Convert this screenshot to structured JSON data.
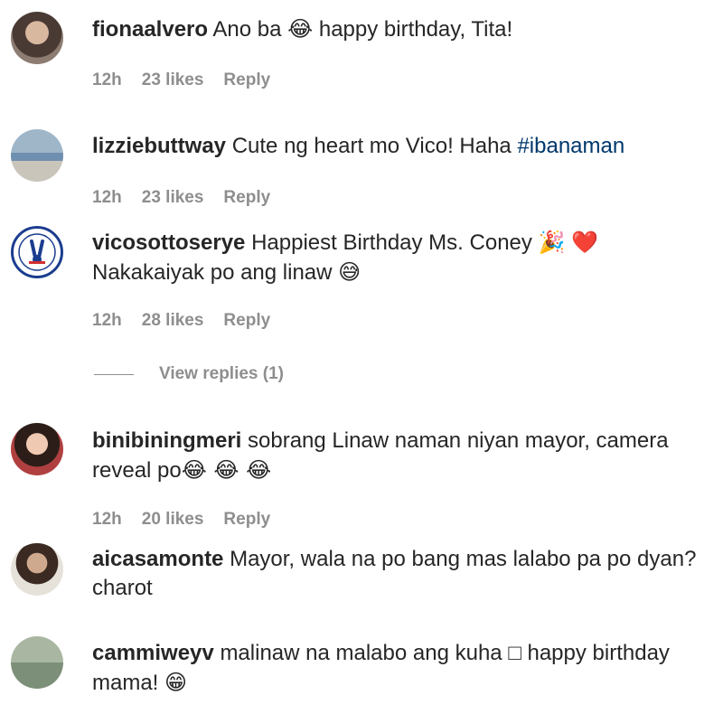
{
  "comments": [
    {
      "user": "fionaalvero",
      "text_before": "Ano ba ",
      "emoji": "😂",
      "text_after": " happy birthday, Tita!",
      "time": "12h",
      "likes": "23 likes",
      "reply": "Reply"
    },
    {
      "user": "lizziebuttway",
      "text_before": "Cute ng heart mo Vico! Haha ",
      "hashtag": "#ibanaman",
      "time": "12h",
      "likes": "23 likes",
      "reply": "Reply"
    },
    {
      "user": "vicosottoserye",
      "text_before": "Happiest Birthday Ms. Coney ",
      "emoji": "🎉",
      "emoji2": "❤️",
      "text_after": " Nakakaiyak po ang linaw ",
      "emoji3": "😅",
      "time": "12h",
      "likes": "28 likes",
      "reply": "Reply",
      "view_replies": "View replies (1)"
    },
    {
      "user": "binibiningmeri",
      "text_before": "sobrang Linaw naman niyan mayor, camera reveal po",
      "emoji": "😂 😂 😂",
      "time": "12h",
      "likes": "20 likes",
      "reply": "Reply"
    },
    {
      "user": "aicasamonte",
      "text_before": "Mayor, wala na po bang mas lalabo pa po dyan? charot"
    },
    {
      "user": "cammiweyv",
      "text_before": "malinaw na malabo ang kuha ",
      "glyph": "□",
      "text_after": " happy birthday mama! ",
      "emoji": "😁"
    }
  ]
}
